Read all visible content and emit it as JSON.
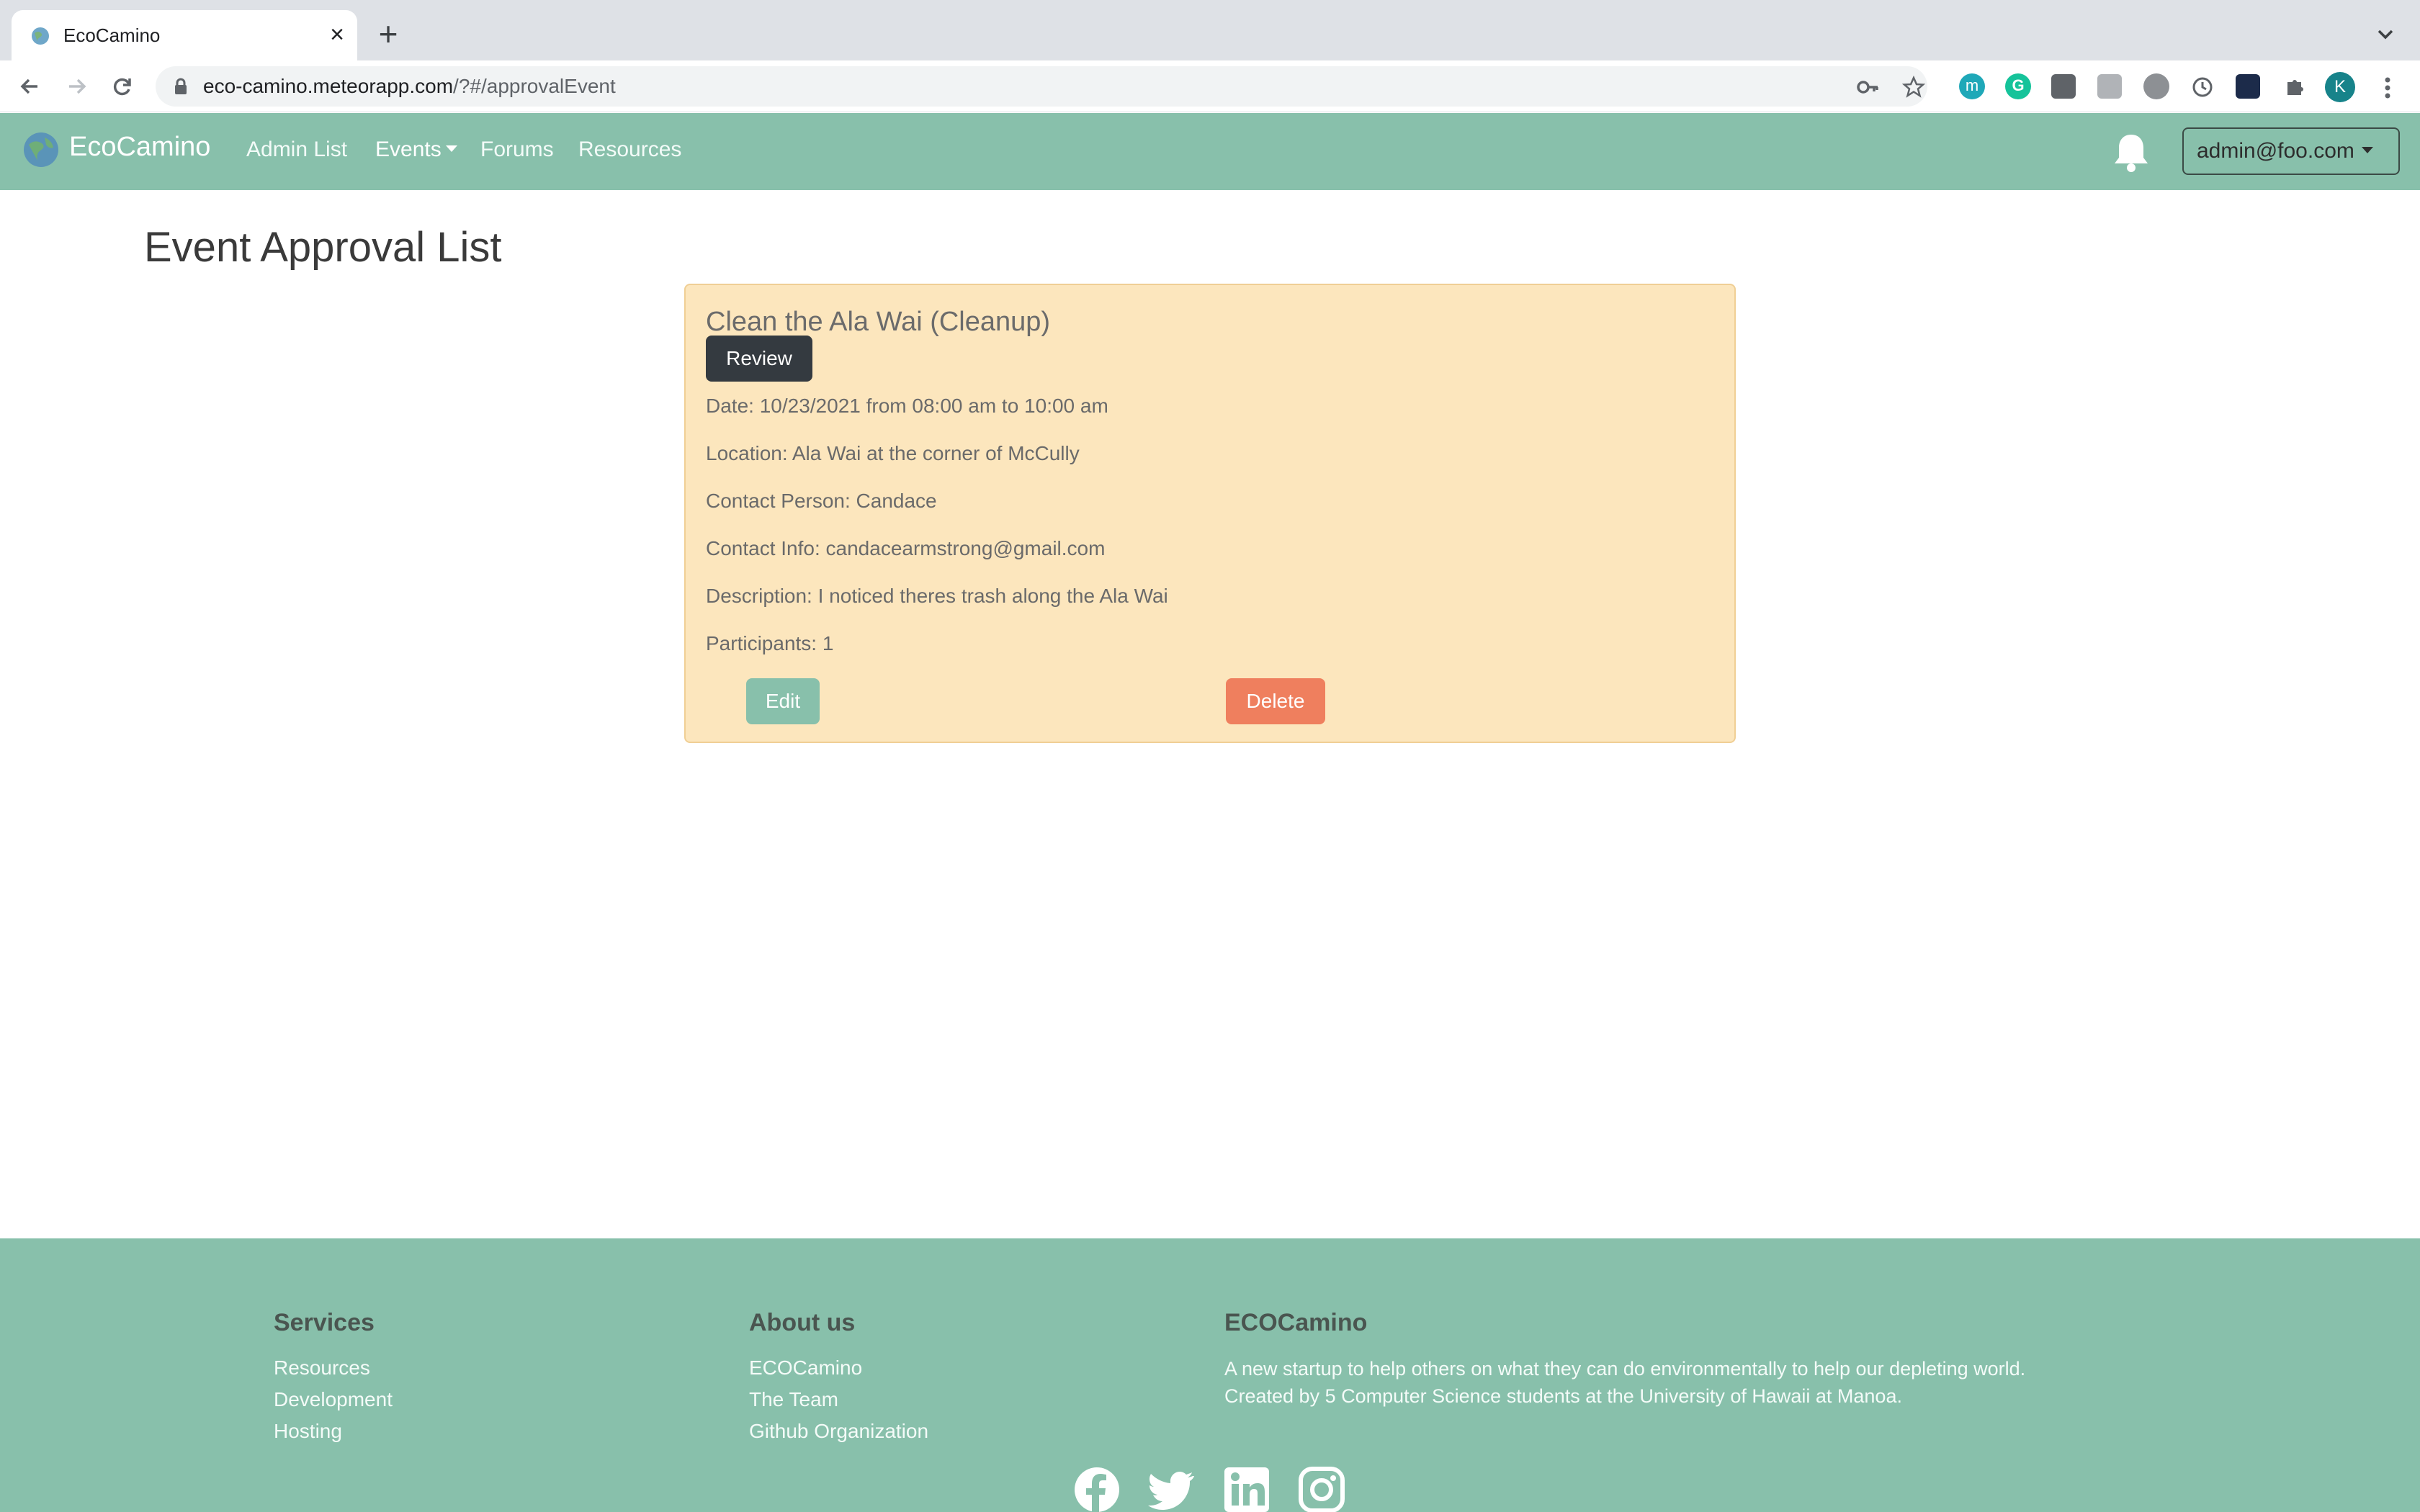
{
  "browser": {
    "tab_title": "EcoCamino",
    "url_host": "eco-camino.meteorapp.com",
    "url_path": "/?#/approvalEvent",
    "profile_initial": "K"
  },
  "nav": {
    "brand": "EcoCamino",
    "links": [
      "Admin List",
      "Events",
      "Forums",
      "Resources"
    ],
    "user": "admin@foo.com"
  },
  "page": {
    "title": "Event Approval List"
  },
  "event": {
    "title": "Clean the Ala Wai (Cleanup)",
    "review_label": "Review",
    "date": "Date: 10/23/2021 from 08:00 am to 10:00 am",
    "location": "Location: Ala Wai at the corner of McCully",
    "contact_person": "Contact Person: Candace",
    "contact_info": "Contact Info: candacearmstrong@gmail.com",
    "description": "Description: I noticed theres trash along the Ala Wai",
    "participants": "Participants: 1",
    "edit_label": "Edit",
    "delete_label": "Delete"
  },
  "footer": {
    "services": {
      "heading": "Services",
      "links": [
        "Resources",
        "Development",
        "Hosting"
      ]
    },
    "about": {
      "heading": "About us",
      "links": [
        "ECOCamino",
        "The Team",
        "Github Organization"
      ]
    },
    "eco": {
      "heading": "ECOCamino",
      "line1": "A new startup to help others on what they can do environmentally to help our depleting world.",
      "line2": "Created by 5 Computer Science students at the University of Hawaii at Manoa."
    },
    "social_icons": [
      "facebook-icon",
      "twitter-icon",
      "linkedin-icon",
      "instagram-icon"
    ]
  },
  "colors": {
    "navbar": "#88c0ab",
    "card": "#fce6bd",
    "review": "#343a40",
    "edit": "#88c0ab",
    "delete": "#ef7f5e"
  }
}
